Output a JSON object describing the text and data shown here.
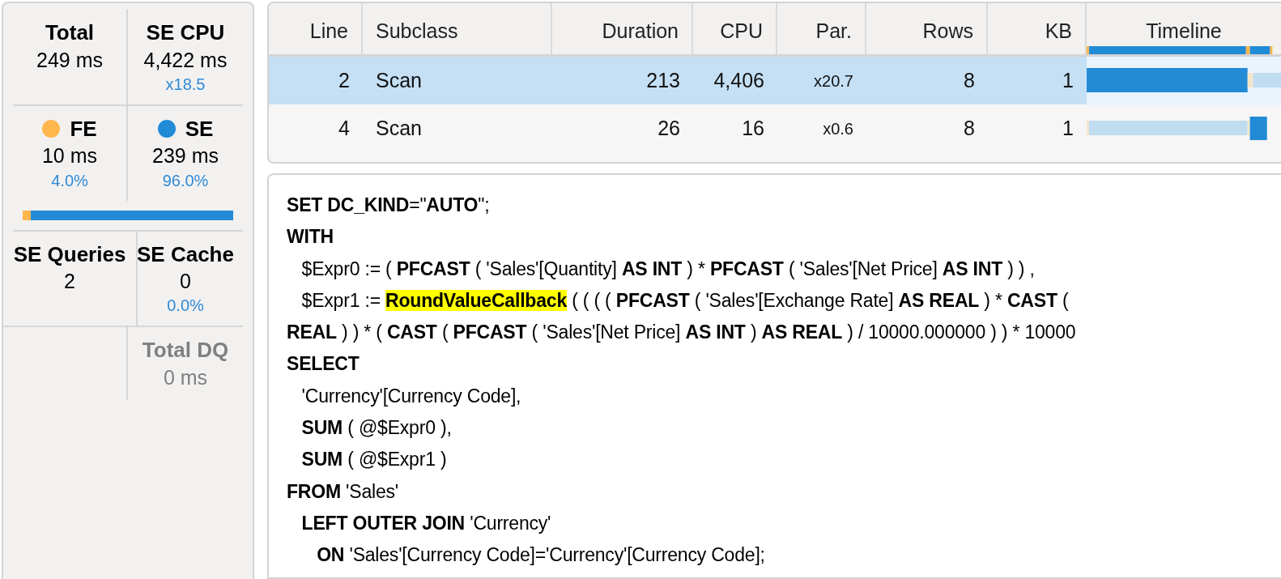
{
  "summary": {
    "total": {
      "label": "Total",
      "value": "249 ms"
    },
    "se_cpu": {
      "label": "SE CPU",
      "value": "4,422 ms",
      "ratio": "x18.5"
    },
    "fe": {
      "label": "FE",
      "value": "10 ms",
      "percent": "4.0%",
      "color": "#ffb74d"
    },
    "se": {
      "label": "SE",
      "value": "239 ms",
      "percent": "96.0%",
      "color": "#228bd6"
    },
    "fe_se_bar": {
      "level": 0.04
    },
    "se_queries": {
      "label": "SE Queries",
      "value": "2"
    },
    "se_cache": {
      "label": "SE Cache",
      "value": "0",
      "percent": "0.0%"
    },
    "total_dq": {
      "label": "Total DQ",
      "value": "0 ms",
      "disabled": true
    }
  },
  "table": {
    "columns": [
      "Line",
      "Subclass",
      "Duration",
      "CPU",
      "Par.",
      "Rows",
      "KB",
      "Timeline"
    ],
    "rows": [
      {
        "line": "2",
        "subclass": "Scan",
        "duration": "213",
        "cpu": "4,406",
        "par": "x20.7",
        "rows": "8",
        "kb": "1",
        "selected": true
      },
      {
        "line": "4",
        "subclass": "Scan",
        "duration": "26",
        "cpu": "16",
        "par": "x0.6",
        "rows": "8",
        "kb": "1",
        "selected": false
      }
    ]
  },
  "query": {
    "lines": [
      [
        {
          "kind": "keyword",
          "text": "SET DC_KIND"
        },
        {
          "kind": "plain",
          "text": "=\""
        },
        {
          "kind": "keyword",
          "text": "AUTO"
        },
        {
          "kind": "plain",
          "text": "\";"
        }
      ],
      [
        {
          "kind": "keyword",
          "text": "WITH"
        }
      ],
      [
        {
          "kind": "plain",
          "text": "   $Expr0 := ( "
        },
        {
          "kind": "keyword",
          "text": "PFCAST"
        },
        {
          "kind": "plain",
          "text": " ( 'Sales'[Quantity] "
        },
        {
          "kind": "keyword",
          "text": "AS INT"
        },
        {
          "kind": "plain",
          "text": " ) * "
        },
        {
          "kind": "keyword",
          "text": "PFCAST"
        },
        {
          "kind": "plain",
          "text": " ( 'Sales'[Net Price] "
        },
        {
          "kind": "keyword",
          "text": "AS INT"
        },
        {
          "kind": "plain",
          "text": " ) ) ,"
        }
      ],
      [
        {
          "kind": "plain",
          "text": "   $Expr1 := "
        },
        {
          "kind": "highlight",
          "text": "RoundValueCallback"
        },
        {
          "kind": "plain",
          "text": " ( ( ( ( "
        },
        {
          "kind": "keyword",
          "text": "PFCAST"
        },
        {
          "kind": "plain",
          "text": " ( 'Sales'[Exchange Rate] "
        },
        {
          "kind": "keyword",
          "text": "AS REAL"
        },
        {
          "kind": "plain",
          "text": " ) * "
        },
        {
          "kind": "keyword",
          "text": "CAST"
        },
        {
          "kind": "plain",
          "text": " ("
        }
      ],
      [
        {
          "kind": "keyword",
          "text": "REAL"
        },
        {
          "kind": "plain",
          "text": " ) ) * ( "
        },
        {
          "kind": "keyword",
          "text": "CAST"
        },
        {
          "kind": "plain",
          "text": " ( "
        },
        {
          "kind": "keyword",
          "text": "PFCAST"
        },
        {
          "kind": "plain",
          "text": " ( 'Sales'[Net Price] "
        },
        {
          "kind": "keyword",
          "text": "AS INT"
        },
        {
          "kind": "plain",
          "text": " ) "
        },
        {
          "kind": "keyword",
          "text": "AS REAL"
        },
        {
          "kind": "plain",
          "text": " ) / 10000.000000 ) ) * 10000"
        }
      ],
      [
        {
          "kind": "keyword",
          "text": "SELECT"
        }
      ],
      [
        {
          "kind": "plain",
          "text": "   'Currency'[Currency Code],"
        }
      ],
      [
        {
          "kind": "keyword",
          "text": "   SUM"
        },
        {
          "kind": "plain",
          "text": " ( @$Expr0 ),"
        }
      ],
      [
        {
          "kind": "keyword",
          "text": "   SUM"
        },
        {
          "kind": "plain",
          "text": " ( @$Expr1 )"
        }
      ],
      [
        {
          "kind": "keyword",
          "text": "FROM"
        },
        {
          "kind": "plain",
          "text": " 'Sales'"
        }
      ],
      [
        {
          "kind": "keyword",
          "text": "   LEFT OUTER JOIN"
        },
        {
          "kind": "plain",
          "text": " 'Currency'"
        }
      ],
      [
        {
          "kind": "keyword",
          "text": "      ON"
        },
        {
          "kind": "plain",
          "text": " 'Sales'[Currency Code]='Currency'[Currency Code];"
        }
      ]
    ]
  }
}
